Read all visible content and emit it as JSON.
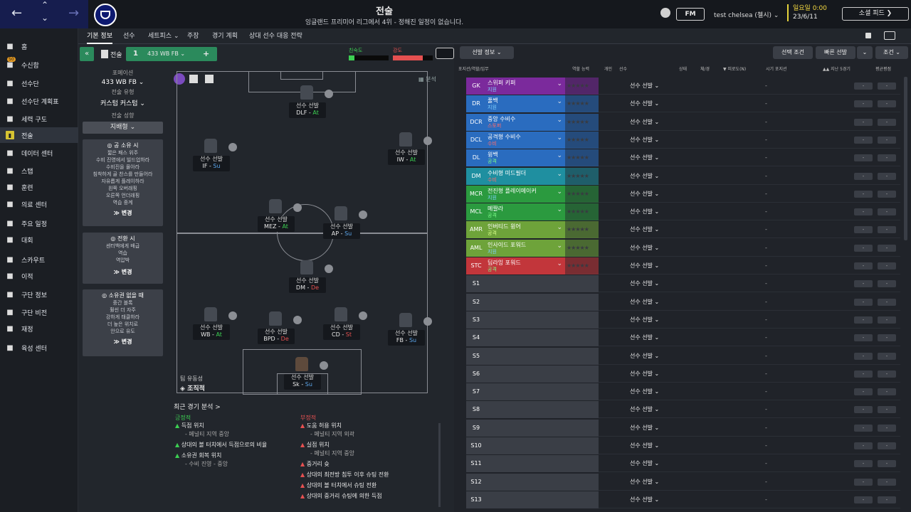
{
  "topbar": {
    "title": "전술",
    "subtitle": "잉글랜드 프리미어 리그에서 4위 - 정해진 일정이 없습니다.",
    "fm_label": "FM",
    "manager": "test chelsea (첼시) ⌄",
    "day": "일요일 0:00",
    "date": "23/6/11",
    "social_button": "소셜 피드"
  },
  "sidebar": {
    "items": [
      {
        "label": "홈",
        "icon": "home-icon"
      },
      {
        "label": "수신함",
        "icon": "inbox-icon",
        "badge": "50"
      },
      {
        "label": "선수단",
        "icon": "shirt-icon"
      },
      {
        "label": "선수단 계획표",
        "icon": "planner-icon"
      },
      {
        "label": "세력 구도",
        "icon": "dynamics-icon"
      },
      {
        "label": "전술",
        "icon": "tactics-icon"
      },
      {
        "label": "데이터 센터",
        "icon": "data-icon"
      },
      {
        "label": "스탭",
        "icon": "staff-icon"
      },
      {
        "label": "훈련",
        "icon": "training-icon"
      },
      {
        "label": "의료 센터",
        "icon": "medical-icon"
      },
      {
        "label": "주요 일정",
        "icon": "calendar-icon"
      },
      {
        "label": "대회",
        "icon": "trophy-icon"
      },
      {
        "label": "스카우트",
        "icon": "scout-icon"
      },
      {
        "label": "이적",
        "icon": "transfer-icon"
      },
      {
        "label": "구단 정보",
        "icon": "club-icon"
      },
      {
        "label": "구단 비전",
        "icon": "vision-icon"
      },
      {
        "label": "재정",
        "icon": "finance-icon"
      },
      {
        "label": "육성 센터",
        "icon": "development-icon"
      }
    ]
  },
  "subtabs": [
    "기본 정보",
    "선수",
    "세트피스 ⌄",
    "주장",
    "경기 계획",
    "상대 선수 대응 전략"
  ],
  "tactic_bar": {
    "label": "전술",
    "slot": "1",
    "name": "433 WB FB ⌄",
    "add": "+"
  },
  "indicators": {
    "familiarity_label": "친숙도",
    "intensity_label": "강도"
  },
  "left_panel": {
    "formation_label": "포메이션",
    "formation_value": "433 WB FB ⌄",
    "type_label": "전술 유형",
    "type_value": "커스텀 커스텀 ⌄",
    "style_label": "전술 성향",
    "style_value": "지배형",
    "in_possession": {
      "title": "공 소유 시",
      "lines": [
        "짧은 패스 위주",
        "수비 진영에서 빌드업하라",
        "수비진을 몰아라",
        "침착하게 골 찬스를 만들어라",
        "자유롭게 플레이하라",
        "왼쪽 오버래핑",
        "오른쪽 언더래핑",
        "역습 중계"
      ],
      "edit": "≫ 변경"
    },
    "transition": {
      "title": "전환 시",
      "lines": [
        "센터백에게 배급",
        "역습",
        "역압박"
      ],
      "edit": "≫ 변경"
    },
    "out_possession": {
      "title": "소유권 없을 때",
      "lines": [
        "중간 블록",
        "훨씬 더 자주",
        "강하게 태클하라",
        "더 높은 위치로",
        "안으로 유도"
      ],
      "edit": "≫ 변경"
    }
  },
  "pitch": {
    "analysis_label": "분석",
    "fluidity_label": "팀 유동성",
    "fluidity_value": "조직적",
    "players": [
      {
        "pos": "DLF",
        "duty": "At",
        "duty_class": "at",
        "name": "선수 선발"
      },
      {
        "pos": "IF",
        "duty": "Su",
        "duty_class": "su",
        "name": "선수 선발"
      },
      {
        "pos": "IW",
        "duty": "At",
        "duty_class": "at",
        "name": "선수 선발"
      },
      {
        "pos": "MEZ",
        "duty": "At",
        "duty_class": "at",
        "name": "선수 선발"
      },
      {
        "pos": "AP",
        "duty": "Su",
        "duty_class": "su",
        "name": "선수 선발"
      },
      {
        "pos": "DM",
        "duty": "De",
        "duty_class": "de",
        "name": "선수 선발"
      },
      {
        "pos": "WB",
        "duty": "At",
        "duty_class": "at",
        "name": "선수 선발"
      },
      {
        "pos": "BPD",
        "duty": "De",
        "duty_class": "de",
        "name": "선수 선발"
      },
      {
        "pos": "CD",
        "duty": "St",
        "duty_class": "st",
        "name": "선수 선발"
      },
      {
        "pos": "FB",
        "duty": "Su",
        "duty_class": "su",
        "name": "선수 선발"
      },
      {
        "pos": "Sk",
        "duty": "Su",
        "duty_class": "su",
        "name": "선수 선발"
      }
    ]
  },
  "analysis": {
    "header": "최근 경기 분석 >",
    "positive_label": "긍정적",
    "negative_label": "부정적",
    "positives": [
      {
        "title": "득점 위치",
        "sub": "- 페널티 지역 중앙"
      },
      {
        "title": "상대의 볼 터치에서 득점으로의 비율",
        "sub": ""
      },
      {
        "title": "소유권 회복 위치",
        "sub": "- 수비 진영 - 중앙"
      }
    ],
    "negatives": [
      {
        "title": "도움 허용 위치",
        "sub": "- 페널티 지역 외곽"
      },
      {
        "title": "실점 위치",
        "sub": "- 페널티 지역 중앙"
      },
      {
        "title": "중거리 슛",
        "sub": ""
      },
      {
        "title": "상대의 최전방 침투 이후 슈팅 전환",
        "sub": ""
      },
      {
        "title": "상대의 볼 터치에서 슈팅 전환",
        "sub": ""
      },
      {
        "title": "상대의 중거리 슈팅에 의한 득점",
        "sub": ""
      }
    ]
  },
  "right_panel": {
    "view_button": "선발 정보 ⌄",
    "select_button": "선택 조건",
    "quick_button": "빠른 선발",
    "conditions_button": "조건 ⌄",
    "columns": [
      "포지션/역할/임무",
      "역할 능력",
      "개인",
      "선수",
      "상태",
      "체/경",
      "▼ 피로도(N)",
      "시기 포지션",
      "▲▲ 지난 5경기",
      "평균평점"
    ],
    "select_player": "선수 선발",
    "dash": "-",
    "pill": "-",
    "slots": [
      {
        "pos": "GK",
        "role": "스위퍼 키퍼",
        "duty": "지원",
        "color": "#7b2a9c",
        "duty_color": "#7fd1ff"
      },
      {
        "pos": "DR",
        "role": "풀백",
        "duty": "지원",
        "color": "#2a6cbf",
        "duty_color": "#7fd1ff"
      },
      {
        "pos": "DCR",
        "role": "중앙 수비수",
        "duty": "스토퍼",
        "color": "#2a6cbf",
        "duty_color": "#ff6b6b"
      },
      {
        "pos": "DCL",
        "role": "공격형 수비수",
        "duty": "수비",
        "color": "#2a6cbf",
        "duty_color": "#ff6b6b"
      },
      {
        "pos": "DL",
        "role": "윙백",
        "duty": "공격",
        "color": "#2a6cbf",
        "duty_color": "#7dff8a"
      },
      {
        "pos": "DM",
        "role": "수비형 미드필더",
        "duty": "수비",
        "color": "#1f8fa0",
        "duty_color": "#ff6b6b"
      },
      {
        "pos": "MCR",
        "role": "전진형 플레이메이커",
        "duty": "지원",
        "color": "#2b9a3f",
        "duty_color": "#7fd1ff"
      },
      {
        "pos": "MCL",
        "role": "메짤라",
        "duty": "공격",
        "color": "#2b9a3f",
        "duty_color": "#7dff8a"
      },
      {
        "pos": "AMR",
        "role": "인버티드 윙어",
        "duty": "공격",
        "color": "#6ea33a",
        "duty_color": "#d8ff8a"
      },
      {
        "pos": "AML",
        "role": "인사이드 포워드",
        "duty": "지원",
        "color": "#6ea33a",
        "duty_color": "#7fd1ff"
      },
      {
        "pos": "STC",
        "role": "딥라잉 포워드",
        "duty": "공격",
        "color": "#c2363b",
        "duty_color": "#7dff8a"
      },
      {
        "pos": "S1"
      },
      {
        "pos": "S2"
      },
      {
        "pos": "S3"
      },
      {
        "pos": "S4"
      },
      {
        "pos": "S5"
      },
      {
        "pos": "S6"
      },
      {
        "pos": "S7"
      },
      {
        "pos": "S8"
      },
      {
        "pos": "S9"
      },
      {
        "pos": "S10"
      },
      {
        "pos": "S11"
      },
      {
        "pos": "S12"
      },
      {
        "pos": "S13"
      }
    ]
  }
}
